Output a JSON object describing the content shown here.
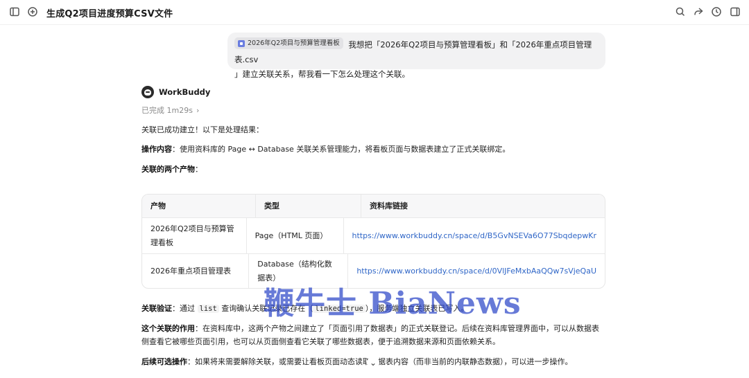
{
  "header": {
    "title": "生成Q2项目进度预算CSV文件"
  },
  "user_message": {
    "chip_label": "2026年Q2项目与预算管理看板",
    "text_line1": "我想把「2026年Q2项目与预算管理看板」和「2026年重点项目管理表.csv",
    "text_line2": "」建立关联关系，帮我看一下怎么处理这个关联。"
  },
  "assistant": {
    "name": "WorkBuddy",
    "status": "已完成 1m29s",
    "intro": "关联已成功建立！以下是处理结果：",
    "op_label": "操作内容",
    "op_text": "：使用资料库的 Page ↔ Database 关联关系管理能力，将看板页面与数据表建立了正式关联绑定。",
    "products_label": "关联的两个产物",
    "products_colon": "：",
    "verify_label": "关联验证",
    "verify_text_a": "：通过 ",
    "verify_code1": "list",
    "verify_text_b": " 查询确认关联记录已存在（",
    "verify_code2": "linked=true",
    "verify_text_c": "），服务端独立关联表已写入。",
    "role_label": "这个关联的作用",
    "role_text": "：在资料库中，这两个产物之间建立了「页面引用了数据表」的正式关联登记。后续在资料库管理界面中，可以从数据表侧查看它被哪些页面引用，也可以从页面侧查看它关联了哪些数据表，便于追溯数据来源和页面依赖关系。",
    "next_label": "后续可选操作",
    "next_text": "：如果将来需要解除关联，或需要让看板页面动态读取数据表内容（而非当前的内联静态数据），可以进一步操作。"
  },
  "table": {
    "headers": [
      "产物",
      "类型",
      "资料库链接"
    ],
    "rows": [
      [
        "2026年Q2项目与预算管理看板",
        "Page（HTML 页面）",
        "https://www.workbuddy.cn/space/d/B5GvNSEVa6O77SbqdepwKr"
      ],
      [
        "2026年重点项目管理表",
        "Database（结构化数据表）",
        "https://www.workbuddy.cn/space/d/0VlJFeMxbAaQQw7sVjeQaU"
      ]
    ]
  },
  "watermark": "鞭牛士 BiaNews",
  "icons": {
    "sidebar": "sidebar-toggle-icon",
    "new_chat": "new-chat-icon",
    "search": "search-icon",
    "share": "share-icon",
    "history": "history-icon",
    "panel": "panel-icon",
    "scroll": "chevron-down-icon"
  },
  "colors": {
    "link": "#2f66c7",
    "bubble": "#f2f2f3",
    "watermark": "#2d46c8"
  }
}
